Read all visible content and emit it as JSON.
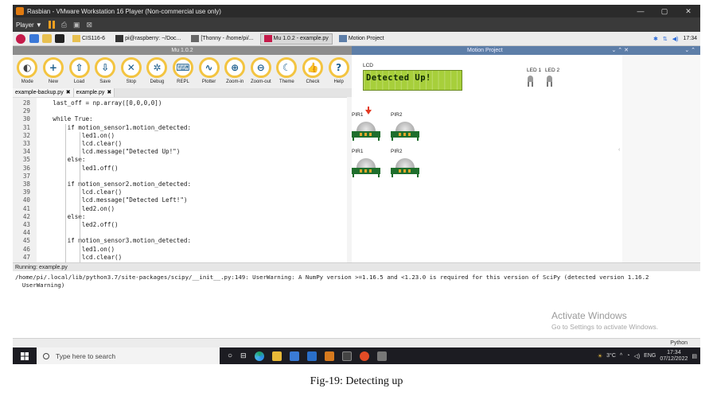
{
  "vmware": {
    "title": "Rasbian - VMware Workstation 16 Player (Non-commercial use only)",
    "menu_player": "Player ▼",
    "controls": {
      "minimize": "—",
      "maximize": "▢",
      "close": "✕"
    }
  },
  "raspbian_taskbar": {
    "tasks": [
      {
        "label": "CIS116-6",
        "active": false
      },
      {
        "label": "pi@raspberry: ~/Doc...",
        "active": false
      },
      {
        "label": "[Thonny - /home/pi/...",
        "active": false
      },
      {
        "label": "Mu 1.0.2 - example.py",
        "active": true
      },
      {
        "label": "Motion Project",
        "active": false
      }
    ],
    "clock": "17:34"
  },
  "mu": {
    "title": "Mu 1.0.2",
    "toolbar": [
      {
        "label": "Mode",
        "glyph": "◐",
        "icon": "mode-icon"
      },
      {
        "label": "New",
        "glyph": "+",
        "icon": "new-icon"
      },
      {
        "label": "Load",
        "glyph": "⇧",
        "icon": "load-icon"
      },
      {
        "label": "Save",
        "glyph": "⇩",
        "icon": "save-icon"
      },
      {
        "label": "Stop",
        "glyph": "✕",
        "icon": "stop-icon"
      },
      {
        "label": "Debug",
        "glyph": "✲",
        "icon": "debug-icon"
      },
      {
        "label": "REPL",
        "glyph": "⌨",
        "icon": "repl-icon"
      },
      {
        "label": "Plotter",
        "glyph": "∿",
        "icon": "plotter-icon"
      },
      {
        "label": "Zoom-in",
        "glyph": "⊕",
        "icon": "zoom-in-icon"
      },
      {
        "label": "Zoom-out",
        "glyph": "⊖",
        "icon": "zoom-out-icon"
      },
      {
        "label": "Theme",
        "glyph": "☾",
        "icon": "theme-icon"
      },
      {
        "label": "Check",
        "glyph": "👍",
        "icon": "check-icon"
      },
      {
        "label": "Help",
        "glyph": "?",
        "icon": "help-icon"
      }
    ],
    "tabs": [
      {
        "label": "example-backup.py",
        "close": "✖"
      },
      {
        "label": "example.py",
        "close": "✖"
      }
    ],
    "code": [
      {
        "n": "28",
        "indent": 1,
        "text": "last_off = np.array([0,0,0,0])"
      },
      {
        "n": "29",
        "indent": 0,
        "text": ""
      },
      {
        "n": "30",
        "indent": 1,
        "text": "while True:"
      },
      {
        "n": "31",
        "indent": 2,
        "text": "if motion_sensor1.motion_detected:"
      },
      {
        "n": "32",
        "indent": 3,
        "text": "led1.on()"
      },
      {
        "n": "33",
        "indent": 3,
        "text": "lcd.clear()"
      },
      {
        "n": "34",
        "indent": 3,
        "text": "lcd.message(\"Detected Up!\")"
      },
      {
        "n": "35",
        "indent": 2,
        "text": "else:"
      },
      {
        "n": "36",
        "indent": 3,
        "text": "led1.off()"
      },
      {
        "n": "37",
        "indent": 0,
        "text": ""
      },
      {
        "n": "38",
        "indent": 2,
        "text": "if motion_sensor2.motion_detected:"
      },
      {
        "n": "39",
        "indent": 3,
        "text": "lcd.clear()"
      },
      {
        "n": "40",
        "indent": 3,
        "text": "lcd.message(\"Detected Left!\")"
      },
      {
        "n": "41",
        "indent": 3,
        "text": "led2.on()"
      },
      {
        "n": "42",
        "indent": 2,
        "text": "else:"
      },
      {
        "n": "43",
        "indent": 3,
        "text": "led2.off()"
      },
      {
        "n": "44",
        "indent": 0,
        "text": ""
      },
      {
        "n": "45",
        "indent": 2,
        "text": "if motion_sensor3.motion_detected:"
      },
      {
        "n": "46",
        "indent": 3,
        "text": "led1.on()"
      },
      {
        "n": "47",
        "indent": 3,
        "text": "lcd.clear()"
      }
    ],
    "running_label": "Running: example.py",
    "output": "/home/pi/.local/lib/python3.7/site-packages/scipy/__init__.py:149: UserWarning: A NumPy version >=1.16.5 and <1.23.0 is required for this version of SciPy (detected version 1.16.2\n  UserWarning)",
    "mode_label": "Python"
  },
  "motion_project": {
    "title": "Motion Project",
    "title_controls": "⌄  ⌃  ✕",
    "title_controls2": "⌄  ⌃",
    "lcd_label": "LCD",
    "lcd_text": "Detected Up!",
    "led_labels": [
      "LED 1",
      "LED 2"
    ],
    "pir_top": [
      "PIR1",
      "PIR2"
    ],
    "pir_bottom": [
      "PIR1",
      "PIR2"
    ],
    "marker": "‹"
  },
  "activate_windows": {
    "title": "Activate Windows",
    "subtitle": "Go to Settings to activate Windows."
  },
  "windows_taskbar": {
    "search_placeholder": "Type here to search",
    "weather": "3°C",
    "language": "ENG",
    "clock_time": "17:34",
    "clock_date": "07/12/2022"
  },
  "caption": "Fig-19: Detecting up",
  "colors": {
    "toolbar_ring": "#f3c441",
    "lcd_green": "#a7cf3b",
    "pir_board": "#1f6e2c",
    "arrow_red": "#e33b24"
  }
}
